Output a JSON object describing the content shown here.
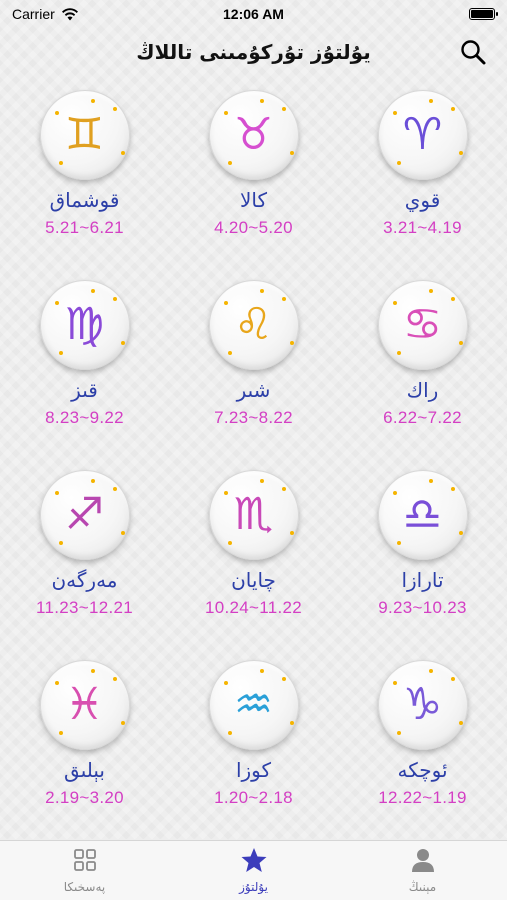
{
  "status_bar": {
    "carrier": "Carrier",
    "time": "12:06 AM"
  },
  "nav": {
    "title": "يۇلتۇز تۇركۇمىنى تاللاڭ",
    "search_icon": "search-icon"
  },
  "colors": {
    "name": "#2c3fa8",
    "date": "#d43fc4",
    "tab_active": "#3c3dbb",
    "tab_inactive": "#8a8a8a"
  },
  "signs": [
    {
      "name": "قوي",
      "date": "3.21~4.19",
      "icon": "aries-icon",
      "glyph": "♈",
      "color": "#6b4fd8"
    },
    {
      "name": "كالا",
      "date": "4.20~5.20",
      "icon": "taurus-icon",
      "glyph": "♉",
      "color": "#d64fd0"
    },
    {
      "name": "قوشماق",
      "date": "5.21~6.21",
      "icon": "gemini-icon",
      "glyph": "♊",
      "color": "#e0a020"
    },
    {
      "name": "راك",
      "date": "6.22~7.22",
      "icon": "cancer-icon",
      "glyph": "♋",
      "color": "#d94fb8"
    },
    {
      "name": "شىر",
      "date": "7.23~8.22",
      "icon": "leo-icon",
      "glyph": "♌",
      "color": "#e8a61b"
    },
    {
      "name": "قىز",
      "date": "8.23~9.22",
      "icon": "virgo-icon",
      "glyph": "♍",
      "color": "#8a4ad8"
    },
    {
      "name": "تارازا",
      "date": "9.23~10.23",
      "icon": "libra-icon",
      "glyph": "♎",
      "color": "#7a4fd8"
    },
    {
      "name": "چايان",
      "date": "10.24~11.22",
      "icon": "scorpio-icon",
      "glyph": "♏",
      "color": "#c94ab8"
    },
    {
      "name": "مەرگەن",
      "date": "11.23~12.21",
      "icon": "sagittarius-icon",
      "glyph": "♐",
      "color": "#b847b0"
    },
    {
      "name": "ئوچكە",
      "date": "12.22~1.19",
      "icon": "capricorn-icon",
      "glyph": "♑",
      "color": "#7a5ad8"
    },
    {
      "name": "كوزا",
      "date": "1.20~2.18",
      "icon": "aquarius-icon",
      "glyph": "♒",
      "color": "#2aa0d8"
    },
    {
      "name": "بېلىق",
      "date": "2.19~3.20",
      "icon": "pisces-icon",
      "glyph": "♓",
      "color": "#d84fb0"
    }
  ],
  "tabs": [
    {
      "label": "پەسخىكا",
      "icon": "grid-icon",
      "active": false
    },
    {
      "label": "يۇلتۇز",
      "icon": "star-icon",
      "active": true
    },
    {
      "label": "مېنىڭ",
      "icon": "person-icon",
      "active": false
    }
  ]
}
